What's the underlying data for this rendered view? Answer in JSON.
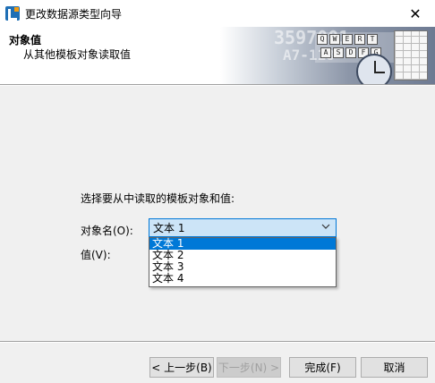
{
  "window": {
    "title": "更改数据源类型向导",
    "close_glyph": "✕"
  },
  "header": {
    "title": "对象值",
    "subtitle": "从其他模板对象读取值"
  },
  "banner": {
    "digits_1": "3597001",
    "digits_2": "A7-118",
    "keys_row1": [
      "Q",
      "W",
      "E",
      "R",
      "T"
    ],
    "keys_row2": [
      "A",
      "S",
      "D",
      "F",
      "G"
    ]
  },
  "form": {
    "prompt": "选择要从中读取的模板对象和值:",
    "object_name_label": "对象名(O):",
    "value_label": "值(V):",
    "combo_value": "文本 1",
    "chevron_icon": "chevron-down-icon",
    "dropdown_options": [
      "文本 1",
      "文本 2",
      "文本 3",
      "文本 4"
    ],
    "selected_index": 0
  },
  "buttons": {
    "back": "< 上一步(B)",
    "next": "下一步(N) >",
    "finish": "完成(F)",
    "cancel": "取消"
  },
  "colors": {
    "selection": "#0078d7",
    "combo_bg": "#cce4f7"
  }
}
